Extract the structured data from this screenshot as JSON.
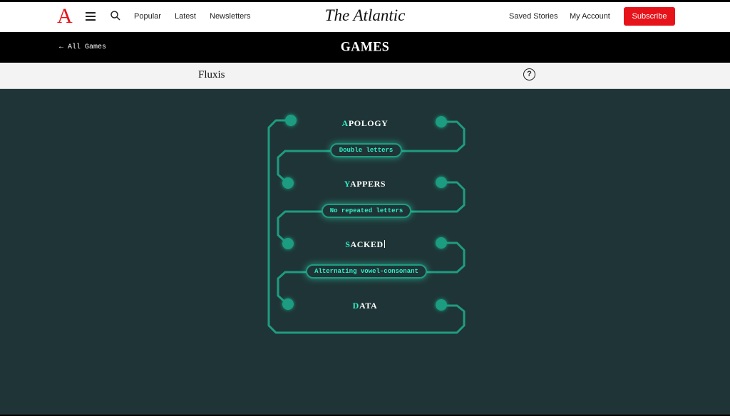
{
  "nav": {
    "logo": "A",
    "menu_icon": "hamburger-icon",
    "search_icon": "search-icon",
    "popular": "Popular",
    "latest": "Latest",
    "newsletters": "Newsletters",
    "masthead": "The Atlantic",
    "saved_stories": "Saved Stories",
    "my_account": "My Account",
    "subscribe": "Subscribe",
    "accent": "#e7131a"
  },
  "games_bar": {
    "back_link": "← All Games",
    "title": "GAMES"
  },
  "game": {
    "name": "Fluxis",
    "help": "?",
    "accent": "#2ff0c8",
    "words": [
      {
        "first": "A",
        "rest": "POLOGY"
      },
      {
        "first": "Y",
        "rest": "APPERS"
      },
      {
        "first": "S",
        "rest": "ACKED",
        "active": true
      },
      {
        "first": "D",
        "rest": "ATA"
      }
    ],
    "rules": [
      "Double letters",
      "No repeated letters",
      "Alternating vowel-consonant"
    ]
  }
}
